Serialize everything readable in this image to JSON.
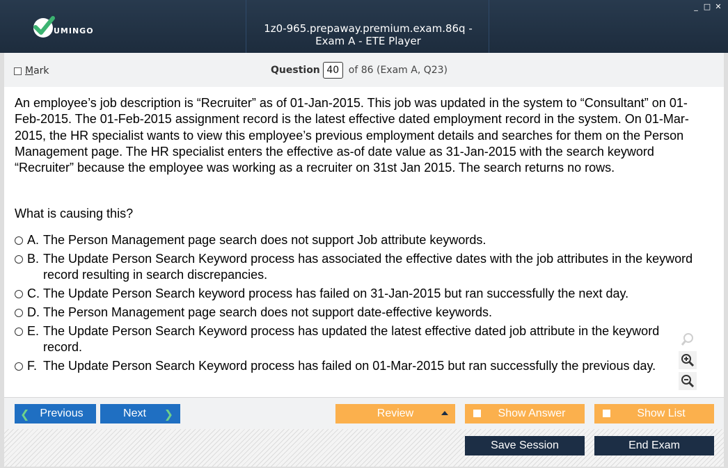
{
  "app": {
    "logo_text": "UMINGO",
    "window_title": "1z0-965.prepaway.premium.exam.86q - Exam A - ETE Player",
    "controls": {
      "minimize": "_",
      "maximize": "□",
      "close": "✕"
    }
  },
  "header": {
    "mark_label_u": "M",
    "mark_label_rest": "ark",
    "question_label": "Question",
    "question_number": "40",
    "question_of": "of 86 (Exam A, Q23)"
  },
  "question": {
    "text": "An employee’s job description is “Recruiter” as of 01-Jan-2015. This job was updated in the system to “Consultant” on 01-Feb-2015. The 01-Feb-2015 assignment record is the latest effective dated employment record in the system. On 01-Mar-2015, the HR specialist wants to view this employee’s previous employment details and searches for them on the Person Management page. The HR specialist enters the effective as-of date value as 31-Jan-2015 with the search keyword “Recruiter” because the employee was working as a recruiter on 31st Jan 2015. The search returns no rows.",
    "prompt": "What is causing this?",
    "options": [
      {
        "letter": "A.",
        "text": "The Person Management page search does not support Job attribute keywords."
      },
      {
        "letter": "B.",
        "text": "The Update Person Search Keyword process has associated the effective dates with the job attributes in the keyword record resulting in search discrepancies."
      },
      {
        "letter": "C.",
        "text": "The Update Person Search keyword process has failed on 31-Jan-2015 but ran successfully the next day."
      },
      {
        "letter": "D.",
        "text": "The Person Management page search does not support date-effective keywords."
      },
      {
        "letter": "E.",
        "text": "The Update Person Search Keyword process has updated the latest effective dated job attribute in the keyword record."
      },
      {
        "letter": "F.",
        "text": "The Update Person Search Keyword process has failed on 01-Mar-2015 but ran successfully the previous day."
      }
    ]
  },
  "navbar": {
    "previous": "Previous",
    "next": "Next",
    "review": "Review",
    "show_answer": "Show Answer",
    "show_list": "Show List"
  },
  "footer": {
    "save_session": "Save Session",
    "end_exam": "End Exam"
  },
  "colors": {
    "titlebar": "#1d2c3d",
    "nav_blue": "#1f6fc2",
    "orange": "#fbb04d",
    "dark_button": "#1c2e45",
    "logo_green": "#3cb371"
  }
}
